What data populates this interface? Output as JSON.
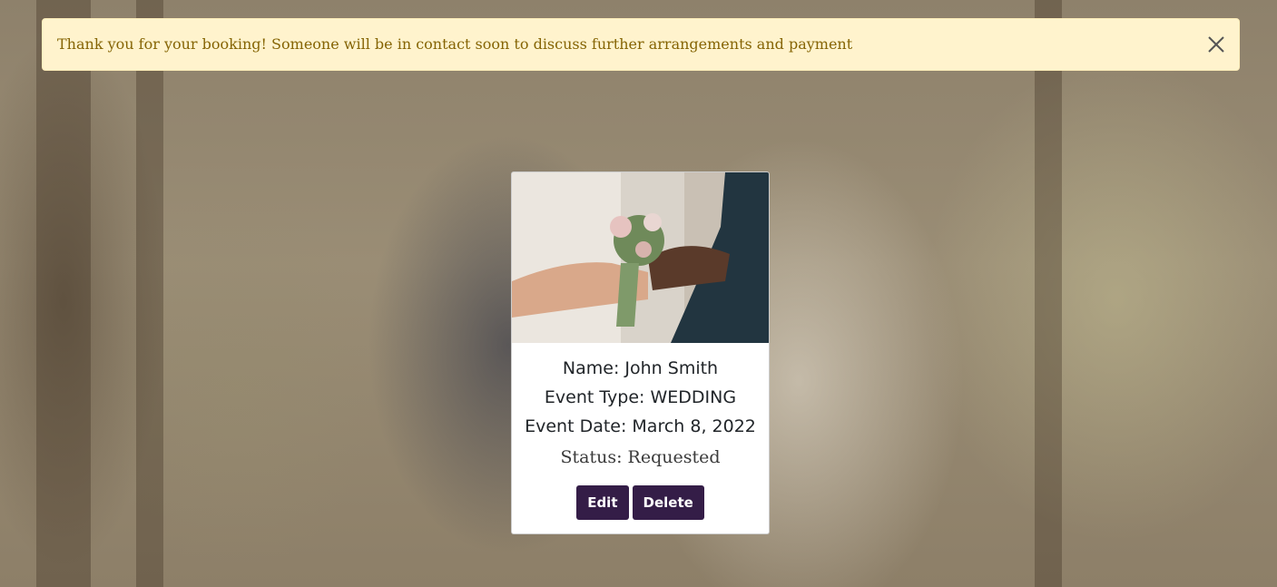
{
  "alert": {
    "message": "Thank you for your booking! Someone will be in contact soon to discuss further arrangements and payment",
    "close_icon": "close-icon"
  },
  "booking": {
    "name_line": "Name: John Smith",
    "event_type_line": "Event Type: WEDDING",
    "event_date_line": "Event Date: March 8, 2022",
    "status_line": "Status: Requested",
    "edit_label": "Edit",
    "delete_label": "Delete"
  },
  "colors": {
    "alert_bg": "#fff3cd",
    "alert_text": "#856404",
    "button_bg": "#341d47",
    "button_text": "#ffffff"
  }
}
